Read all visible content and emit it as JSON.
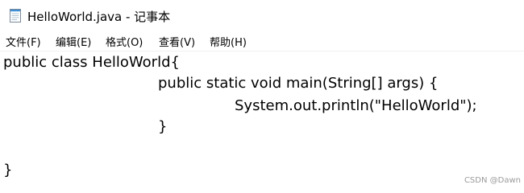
{
  "window": {
    "title": "HelloWorld.java - 记事本"
  },
  "menu": {
    "items": [
      {
        "label": "文件(F)"
      },
      {
        "label": "编辑(E)"
      },
      {
        "label": "格式(O)"
      },
      {
        "label": "查看(V)"
      },
      {
        "label": "帮助(H)"
      }
    ]
  },
  "editor": {
    "lines": [
      "public class HelloWorld{",
      "public static void main(String[] args) {",
      "System.out.println(\"HelloWorld\");",
      "}",
      "",
      "}"
    ]
  },
  "watermark": {
    "text": "CSDN @Dawn"
  },
  "icons": {
    "app": "notepad-icon"
  }
}
